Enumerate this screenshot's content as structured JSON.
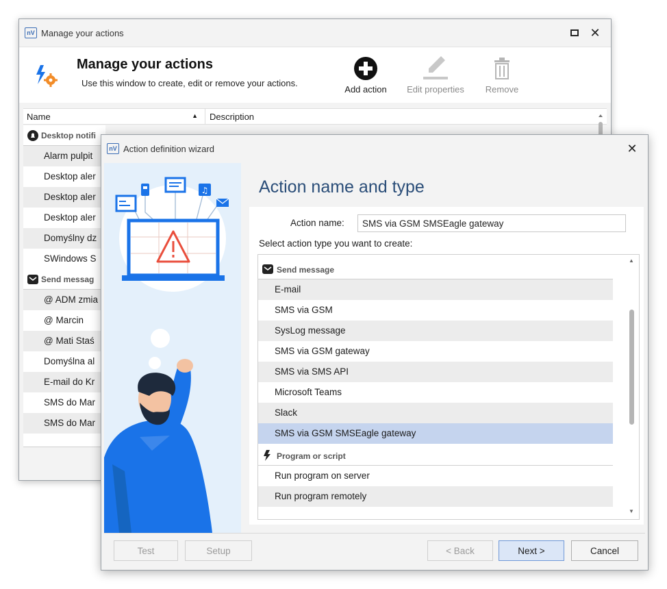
{
  "back_window": {
    "logo": "nV",
    "title": "Manage your actions",
    "header_title": "Manage your actions",
    "header_subtitle": "Use this window to create, edit or remove your actions.",
    "toolbar": {
      "add_label": "Add action",
      "edit_label": "Edit properties",
      "remove_label": "Remove"
    },
    "columns": {
      "name": "Name",
      "description": "Description"
    },
    "groups": [
      {
        "label": "Desktop notifi",
        "icon": "alert-bell-icon"
      },
      {
        "label": "Send messag",
        "icon": "envelope-icon"
      }
    ],
    "desktop_items": [
      "Alarm pulpit",
      "Desktop aler",
      "Desktop aler",
      "Desktop aler",
      "Domyślny dz",
      "SWindows S"
    ],
    "message_items": [
      "@ ADM zmia",
      "@ Marcin",
      "@ Mati Staś",
      "Domyślna al",
      "E-mail do Kr",
      "SMS do Mar",
      "SMS do Mar"
    ]
  },
  "wizard": {
    "logo": "nV",
    "title": "Action definition wizard",
    "heading": "Action name and type",
    "action_name_label": "Action name:",
    "action_name_value": "SMS via GSM SMSEagle gateway",
    "select_label": "Select action type you want to create:",
    "group_send": "Send message",
    "send_items": [
      "E-mail",
      "SMS via GSM",
      "SysLog message",
      "SMS via GSM gateway",
      "SMS via SMS API",
      "Microsoft Teams",
      "Slack",
      "SMS via GSM SMSEagle gateway"
    ],
    "selected_item": "SMS via GSM SMSEagle gateway",
    "group_program": "Program or script",
    "program_items": [
      "Run program on server",
      "Run program remotely"
    ],
    "buttons": {
      "test": "Test",
      "setup": "Setup",
      "back": "< Back",
      "next": "Next >",
      "cancel": "Cancel"
    }
  },
  "colors": {
    "accent_blue": "#1a73e8",
    "heading": "#2a4d78",
    "selection": "#c5d4ee",
    "illustration_bg": "#e4f0fb"
  }
}
